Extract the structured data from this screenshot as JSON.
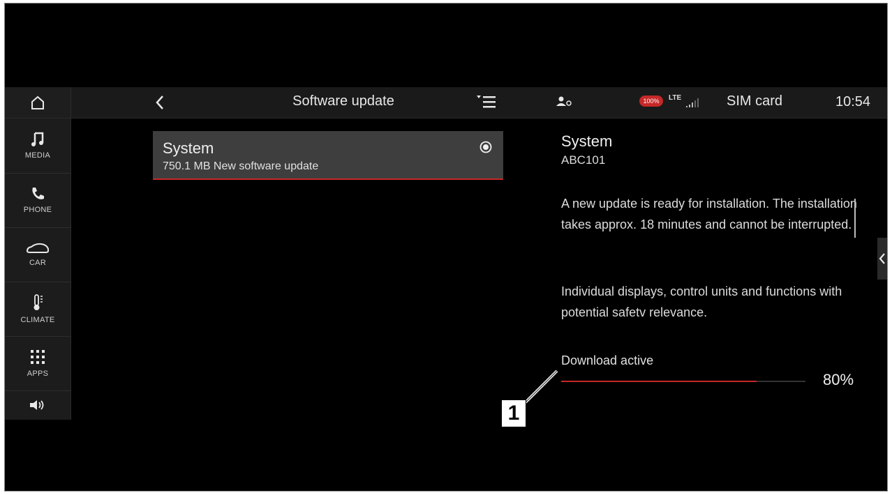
{
  "statusbar": {
    "title": "Software update",
    "battery_badge": "100%",
    "network": "LTE",
    "sim_label": "SIM card",
    "time": "10:54"
  },
  "sidebar": {
    "items": [
      {
        "label": "MEDIA",
        "icon": "music-note-icon"
      },
      {
        "label": "PHONE",
        "icon": "phone-icon"
      },
      {
        "label": "CAR",
        "icon": "car-icon"
      },
      {
        "label": "CLIMATE",
        "icon": "thermometer-icon"
      },
      {
        "label": "APPS",
        "icon": "apps-grid-icon"
      },
      {
        "label": "",
        "icon": "volume-icon"
      }
    ]
  },
  "list": {
    "items": [
      {
        "title": "System",
        "subtitle": "750.1 MB New software update",
        "selected": true
      }
    ]
  },
  "detail": {
    "title": "System",
    "code": "ABC101",
    "paragraph1": "A new update is ready for installation. The installation takes approx. 18 minutes and cannot be interrupted.",
    "paragraph2": "Individual displays, control units and functions with potential safetv relevance.",
    "download_label": "Download active",
    "progress_percent": 80,
    "progress_text": "80%"
  },
  "callout": {
    "number": "1"
  },
  "colors": {
    "accent": "#c62828",
    "background": "#000000",
    "panel": "#3e3e3e"
  }
}
